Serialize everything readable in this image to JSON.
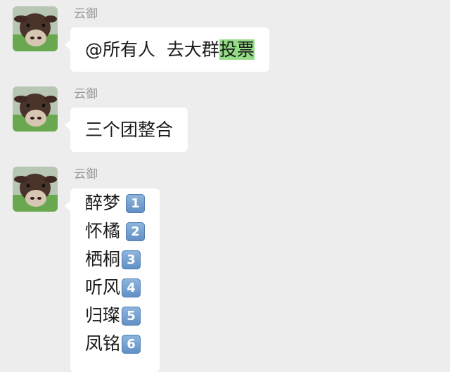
{
  "messages": [
    {
      "sender": "云御",
      "text": "@所有人  去大群",
      "highlight": "投票"
    },
    {
      "sender": "云御",
      "text": "三个团整合"
    },
    {
      "sender": "云御",
      "lines": [
        {
          "name": "醉梦",
          "num": "1"
        },
        {
          "name": "怀橘",
          "num": "2"
        },
        {
          "name": "栖桐",
          "num": "3"
        },
        {
          "name": "听风",
          "num": "4"
        },
        {
          "name": "归璨",
          "num": "5"
        },
        {
          "name": "凤铭",
          "num": "6"
        }
      ]
    }
  ],
  "colors": {
    "background": "#ededed",
    "bubble": "#ffffff",
    "highlight": "#95dc87",
    "sender": "#9a9a9a"
  },
  "icons": {
    "avatar": "cow-avatar-icon",
    "number_badge": "keycap-number-icon"
  }
}
